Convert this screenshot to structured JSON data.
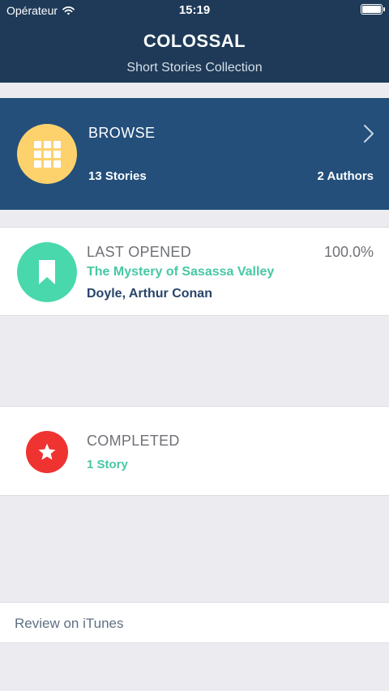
{
  "status_bar": {
    "carrier": "Opérateur",
    "time": "15:19",
    "wifi_icon": "wifi-icon",
    "battery_icon": "battery-icon"
  },
  "header": {
    "title": "COLOSSAL",
    "subtitle": "Short Stories Collection"
  },
  "browse": {
    "label": "BROWSE",
    "stories": "13 Stories",
    "authors": "2 Authors",
    "icon": "grid-icon",
    "chevron_icon": "chevron-right-icon"
  },
  "last_opened": {
    "label": "LAST OPENED",
    "progress": "100.0%",
    "story_title": "The Mystery of Sasassa Valley",
    "author": "Doyle, Arthur Conan",
    "icon": "bookmark-icon"
  },
  "completed": {
    "label": "COMPLETED",
    "count": "1 Story",
    "icon": "star-icon"
  },
  "review": {
    "label": "Review on iTunes"
  },
  "colors": {
    "header_bg": "#1E3A58",
    "browse_bg": "#244F7B",
    "browse_icon_bg": "#FDD26D",
    "last_icon_bg": "#48D8AB",
    "completed_icon_bg": "#EE3330",
    "accent_green": "#46C8A3",
    "author_blue": "#28456A",
    "page_bg": "#ECECF0"
  }
}
